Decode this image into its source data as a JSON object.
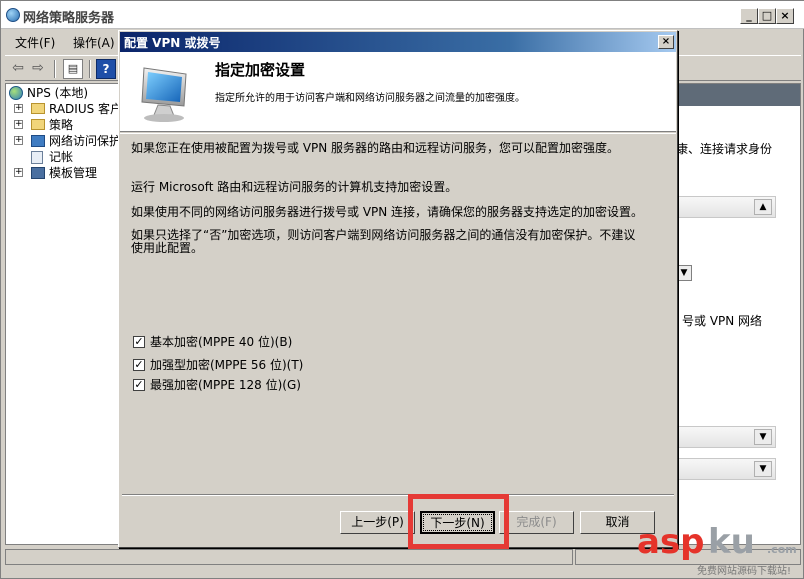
{
  "main_window": {
    "title": "网络策略服务器",
    "controls": {
      "minimize": "_",
      "maximize": "□",
      "close": "×"
    }
  },
  "menu": {
    "file": "文件(F)",
    "action": "操作(A)"
  },
  "toolbar": {
    "back_icon": "⇦",
    "forward_icon": "⇨",
    "tree_icon": "▤",
    "help_icon": "?"
  },
  "tree": {
    "root": "NPS (本地)",
    "items": [
      {
        "expander": "+",
        "label": "RADIUS 客户端"
      },
      {
        "expander": "+",
        "label": "策略"
      },
      {
        "expander": "+",
        "label": "网络访问保护"
      },
      {
        "expander": "",
        "label": "记帐"
      },
      {
        "expander": "+",
        "label": "模板管理"
      }
    ]
  },
  "right_pane": {
    "text_top": "康、连接请求身份",
    "text_mid": "号或 VPN 网络",
    "arrow_up": "▲",
    "arrow_down": "▼"
  },
  "dialog": {
    "title": "配置 VPN 或拨号",
    "close": "×",
    "heading": "指定加密设置",
    "subheading": "指定所允许的用于访问客户端和网络访问服务器之间流量的加密强度。",
    "intro": "如果您正在使用被配置为拨号或 VPN 服务器的路由和远程访问服务，您可以配置加密强度。",
    "runs": "运行 Microsoft 路由和远程访问服务的计算机支持加密设置。",
    "different": "如果使用不同的网络访问服务器进行拨号或 VPN 连接，请确保您的服务器支持选定的加密设置。",
    "warning_line1": "如果只选择了“否”加密选项，则访问客户端到网络访问服务器之间的通信没有加密保护。不建议",
    "warning_line2": "使用此配置。",
    "options": [
      {
        "label": "基本加密(MPPE 40 位)(B)",
        "checked": true
      },
      {
        "label": "加强型加密(MPPE 56 位)(T)",
        "checked": true
      },
      {
        "label": "最强加密(MPPE 128 位)(G)",
        "checked": true
      }
    ],
    "check_mark": "✓",
    "buttons": {
      "back": "上一步(P)",
      "next": "下一步(N)",
      "finish": "完成(F)",
      "cancel": "取消"
    }
  },
  "watermark": {
    "brand_red": "asp",
    "brand_gray": "ku",
    "suffix": ".com",
    "slogan": "免费网站源码下载站!"
  },
  "colors": {
    "highlight": "#e53935",
    "dialog_title_start": "#0a246a",
    "dialog_title_end": "#a6caf0"
  }
}
